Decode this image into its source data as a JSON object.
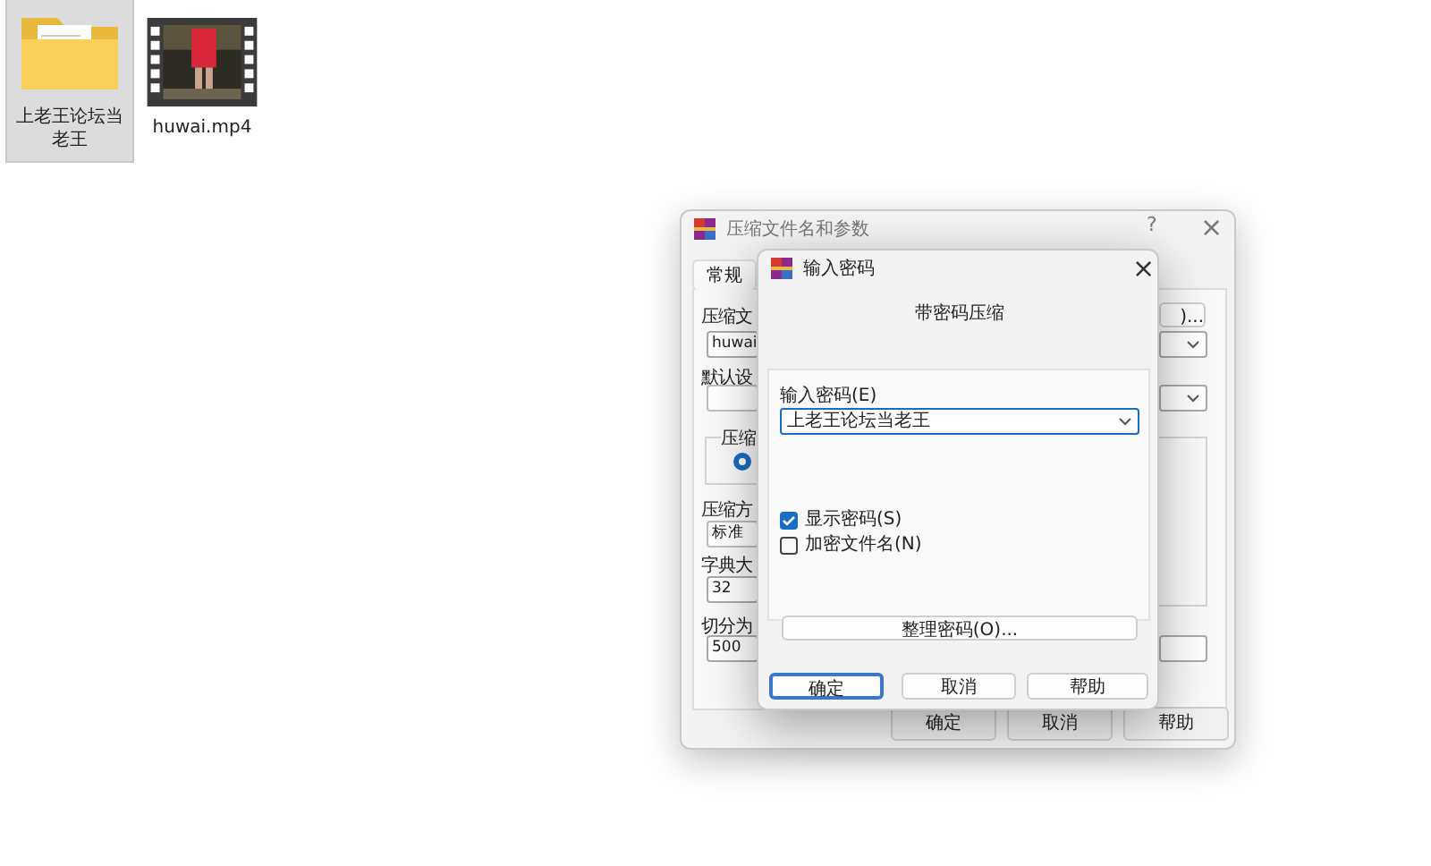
{
  "desktop_icons": [
    {
      "label": "上老王论坛当老王",
      "kind": "folder",
      "selected": true
    },
    {
      "label": "huwai.mp4",
      "kind": "video",
      "selected": false
    }
  ],
  "archive_dialog": {
    "title": "压缩文件名和参数",
    "help": "?",
    "close": "×",
    "tabs": [
      {
        "label": "常规",
        "selected": true
      }
    ],
    "labels": [
      "压缩文",
      "默认设",
      "压缩方",
      "字典大",
      "切分为"
    ],
    "fields": [
      {
        "kind": "text",
        "value": "huwai"
      },
      {
        "kind": "combo"
      },
      {
        "kind": "combo",
        "value": "标准"
      },
      {
        "kind": "text",
        "value": "32"
      },
      {
        "kind": "text",
        "value": "500"
      }
    ],
    "group_label": "压缩",
    "radio": {
      "selected": true
    },
    "browse_button": ")...",
    "buttons": [
      "确定",
      "取消",
      "帮助"
    ]
  },
  "password_dialog": {
    "title": "输入密码",
    "close": "×",
    "heading": "带密码压缩",
    "password_label": "输入密码(E)",
    "password_value": "上老王论坛当老王",
    "options": [
      {
        "label": "显示密码(S)",
        "checked": true
      },
      {
        "label": "加密文件名(N)",
        "checked": false
      }
    ],
    "organize_button": "整理密码(O)...",
    "buttons": [
      {
        "label": "确定",
        "default": true
      },
      {
        "label": "取消",
        "default": false
      },
      {
        "label": "帮助",
        "default": false
      }
    ]
  }
}
